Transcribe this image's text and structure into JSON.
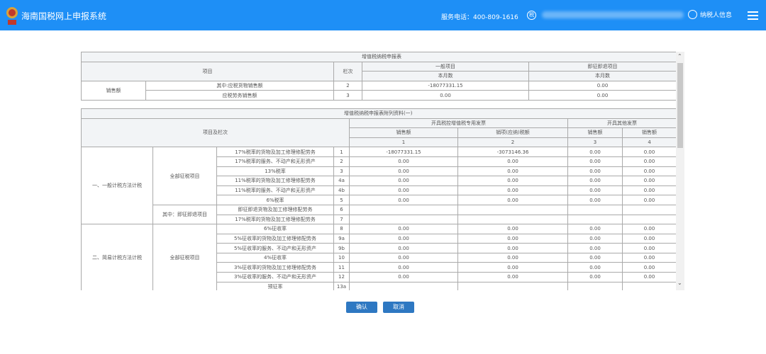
{
  "header": {
    "title": "海南国税网上申报系统",
    "phone": "服务电话：400-809-1616",
    "ent_icon": "税",
    "user": "纳税人信息"
  },
  "table1": {
    "title": "增值税纳税申报表",
    "col_item": "项目",
    "col_line": "栏次",
    "col_general": "一般项目",
    "col_refund": "即征即退项目",
    "sub_month": "本月数",
    "group": "销售额",
    "rows": [
      {
        "item": "其中:应税货物销售额",
        "line": "2",
        "general": "-18077331.15",
        "refund": "0.00"
      },
      {
        "item": "应税劳务销售额",
        "line": "3",
        "general": "0.00",
        "refund": "0.00"
      }
    ]
  },
  "table2": {
    "title": "增值税纳税申报表附列资料(一)",
    "col_item": "项目及栏次",
    "grp_special": "开具税控增值税专用发票",
    "grp_other": "开具其他发票",
    "cols": [
      "销售额",
      "销项(应纳)税额",
      "销售额",
      "销售额"
    ],
    "col_nums": [
      "1",
      "2",
      "3",
      "4"
    ],
    "sec1": "一、一般计税方法计税",
    "sec2": "二、简易计税方法计税",
    "sub_all": "全部征税项目",
    "sub_refund": "其中：即征即退项目",
    "rows": [
      {
        "item": "17%税率的货物及加工修理修配劳务",
        "line": "1",
        "v": [
          "-18077331.15",
          "-3073146.36",
          "0.00",
          "0.00"
        ]
      },
      {
        "item": "17%税率的服务、不动产和无形资产",
        "line": "2",
        "v": [
          "0.00",
          "0.00",
          "0.00",
          "0.00"
        ]
      },
      {
        "item": "13%税率",
        "line": "3",
        "v": [
          "0.00",
          "0.00",
          "0.00",
          "0.00"
        ]
      },
      {
        "item": "11%税率的货物及加工修理修配劳务",
        "line": "4a",
        "v": [
          "0.00",
          "0.00",
          "0.00",
          "0.00"
        ]
      },
      {
        "item": "11%税率的服务、不动产和无形资产",
        "line": "4b",
        "v": [
          "0.00",
          "0.00",
          "0.00",
          "0.00"
        ]
      },
      {
        "item": "6%税率",
        "line": "5",
        "v": [
          "0.00",
          "0.00",
          "0.00",
          "0.00"
        ]
      },
      {
        "item": "即征即退货物及加工修理修配劳务",
        "line": "6",
        "v": [
          "",
          "",
          "",
          ""
        ]
      },
      {
        "item": "17%税率的货物及加工修理修配劳务",
        "line": "7",
        "v": [
          "",
          "",
          "",
          ""
        ]
      },
      {
        "item": "6%征收率",
        "line": "8",
        "v": [
          "0.00",
          "0.00",
          "0.00",
          "0.00"
        ]
      },
      {
        "item": "5%征收率的货物及加工修理修配劳务",
        "line": "9a",
        "v": [
          "0.00",
          "0.00",
          "0.00",
          "0.00"
        ]
      },
      {
        "item": "5%征收率的服务、不动产和无形资产",
        "line": "9b",
        "v": [
          "0.00",
          "0.00",
          "0.00",
          "0.00"
        ]
      },
      {
        "item": "4%征收率",
        "line": "10",
        "v": [
          "0.00",
          "0.00",
          "0.00",
          "0.00"
        ]
      },
      {
        "item": "3%征收率的货物及加工修理修配劳务",
        "line": "11",
        "v": [
          "0.00",
          "0.00",
          "0.00",
          "0.00"
        ]
      },
      {
        "item": "3%征收率的服务、不动产和无形资产",
        "line": "12",
        "v": [
          "0.00",
          "0.00",
          "0.00",
          "0.00"
        ]
      },
      {
        "item": "预征率",
        "line": "13a",
        "v": [
          "",
          "",
          "",
          ""
        ]
      }
    ]
  },
  "buttons": {
    "confirm": "确认",
    "cancel": "取消"
  }
}
